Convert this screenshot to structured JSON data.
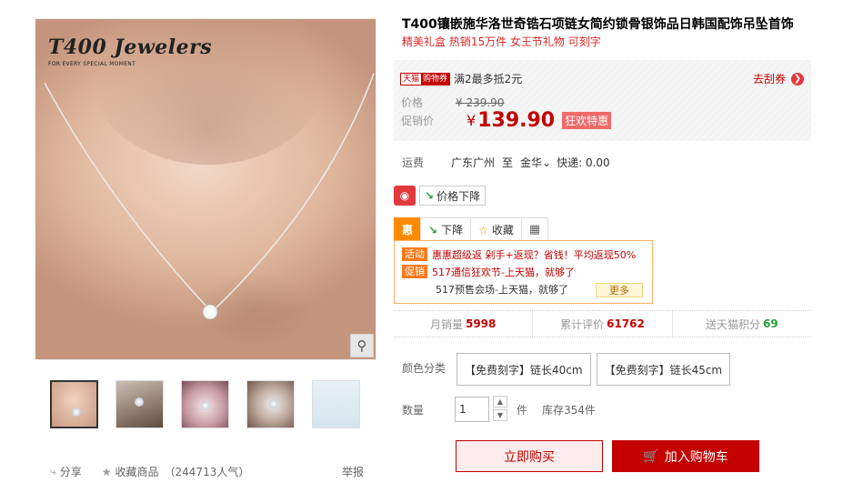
{
  "gallery": {
    "brand_logo": "T400 Jewelers",
    "brand_tagline": "FOR EVERY SPECIAL MOMENT",
    "zoom_icon": "magnifier-icon",
    "thumb_count": 5
  },
  "social": {
    "share": "分享",
    "favorite": "收藏商品",
    "popularity": "（244713人气）",
    "report": "举报"
  },
  "product": {
    "title": "T400镶嵌施华洛世奇锆石项链女简约锁骨银饰品日韩国配饰吊坠首饰",
    "subtitle": "精美礼盒 热销15万件 女王节礼物 可刻字"
  },
  "price": {
    "tmall_tag_a": "天猫",
    "tmall_tag_b": "购物券",
    "promo_text": "满2最多抵2元",
    "coupon_link": "去刮券",
    "orig_label": "价格",
    "orig_value": "¥ 239.90",
    "promo_label": "促销价",
    "yen": "¥",
    "promo_value": "139.90",
    "badge": "狂欢特惠"
  },
  "shipping": {
    "label": "运费",
    "from": "广东广州",
    "to_word": "至",
    "to": "金华",
    "express": "快递: 0.00"
  },
  "price_drop": {
    "icon_text": "@@",
    "label": "价格下降"
  },
  "tabs": {
    "hui": "惠",
    "drop": "下降",
    "collect": "收藏"
  },
  "promotions": {
    "row1_label": "活动",
    "row1_text": "惠惠超级返 剁手+返现？省钱！平均返现50%",
    "row2_label": "促销",
    "row2_text": "517通信狂欢节-上天猫，就够了",
    "row3_text": "517预售会场-上天猫，就够了",
    "more": "更多"
  },
  "stats": {
    "monthly_label": "月销量",
    "monthly_value": "5998",
    "reviews_label": "累计评价",
    "reviews_value": "61762",
    "points_label": "送天猫积分",
    "points_value": "69"
  },
  "options": {
    "color_label": "颜色分类",
    "opt1": "【免费刻字】链长40cm",
    "opt2": "【免费刻字】链长45cm"
  },
  "quantity": {
    "label": "数量",
    "value": "1",
    "unit": "件",
    "stock": "库存354件"
  },
  "actions": {
    "buy": "立即购买",
    "cart": "加入购物车"
  }
}
